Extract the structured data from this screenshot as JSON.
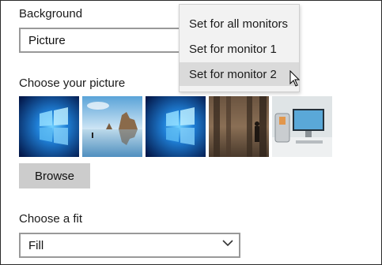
{
  "background": {
    "heading": "Background",
    "selected_value": "Picture"
  },
  "picture": {
    "heading": "Choose your picture",
    "thumbnails": [
      {
        "icon": "windows-hero-blue"
      },
      {
        "icon": "beach-rocks-reflection"
      },
      {
        "icon": "windows-hero-blue"
      },
      {
        "icon": "sepia-forest-figure"
      },
      {
        "icon": "computer-desk-photo"
      }
    ],
    "browse_label": "Browse"
  },
  "fit": {
    "heading": "Choose a fit",
    "selected_value": "Fill"
  },
  "context_menu": {
    "items": [
      {
        "label": "Set for all monitors"
      },
      {
        "label": "Set for monitor 1"
      },
      {
        "label": "Set for monitor 2",
        "hovered": true
      }
    ]
  },
  "colors": {
    "hover": "#dadada",
    "button": "#cccccc",
    "menu_bg": "#f2f2f2"
  }
}
